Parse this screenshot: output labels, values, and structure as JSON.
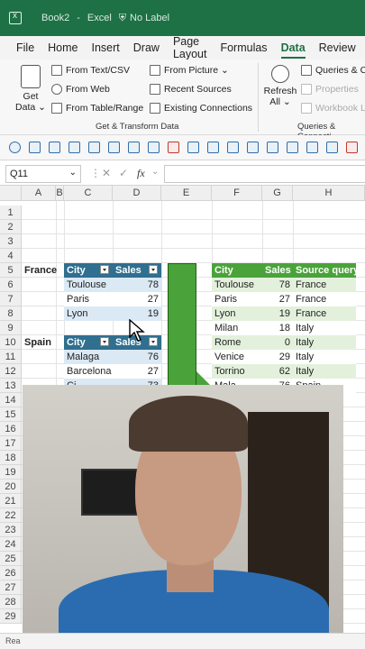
{
  "title_bar": {
    "app_icon": "excel-icon",
    "book": "Book2",
    "separator": "-",
    "app": "Excel",
    "label_icon": "shield-icon",
    "label": "No Label"
  },
  "menu": [
    "File",
    "Home",
    "Insert",
    "Draw",
    "Page Layout",
    "Formulas",
    "Data",
    "Review"
  ],
  "menu_active": "Data",
  "ribbon": {
    "get_data": "Get",
    "get_data2": "Data",
    "from_text_csv": "From Text/CSV",
    "from_web": "From Web",
    "from_table_range": "From Table/Range",
    "from_picture": "From Picture",
    "recent_sources": "Recent Sources",
    "existing_connections": "Existing Connections",
    "group_get_transform": "Get & Transform Data",
    "refresh": "Refresh",
    "refresh_all": "All",
    "queries_conn": "Queries & Co",
    "properties": "Properties",
    "workbook_links": "Workbook Li",
    "group_queries": "Queries & Connecti"
  },
  "formula_bar": {
    "name_box": "Q11",
    "fx": "fx",
    "formula": ""
  },
  "columns": [
    "A",
    "B",
    "C",
    "D",
    "E",
    "F",
    "G",
    "H"
  ],
  "rows": [
    "1",
    "2",
    "3",
    "4",
    "5",
    "6",
    "7",
    "8",
    "9",
    "10",
    "11",
    "12",
    "13",
    "14",
    "15",
    "16",
    "17",
    "18",
    "19",
    "20",
    "21",
    "22",
    "23",
    "24",
    "25",
    "26",
    "27",
    "28",
    "29"
  ],
  "sheet": {
    "france_label": "France",
    "spain_label": "Spain",
    "france_table": {
      "headers": [
        "City",
        "Sales"
      ],
      "rows": [
        [
          "Toulouse",
          "78"
        ],
        [
          "Paris",
          "27"
        ],
        [
          "Lyon",
          "19"
        ]
      ]
    },
    "spain_table": {
      "headers": [
        "City",
        "Sales"
      ],
      "rows": [
        [
          "Malaga",
          "76"
        ],
        [
          "Barcelona",
          "27"
        ],
        [
          "Ci",
          "73"
        ]
      ]
    },
    "combined_table": {
      "headers": [
        "City",
        "Sales",
        "Source query"
      ],
      "rows": [
        [
          "Toulouse",
          "78",
          "France"
        ],
        [
          "Paris",
          "27",
          "France"
        ],
        [
          "Lyon",
          "19",
          "France"
        ],
        [
          "Milan",
          "18",
          "Italy"
        ],
        [
          "Rome",
          "0",
          "Italy"
        ],
        [
          "Venice",
          "29",
          "Italy"
        ],
        [
          "Torrino",
          "62",
          "Italy"
        ],
        [
          "Mala",
          "76",
          "Spain"
        ]
      ]
    }
  },
  "status_bar": {
    "text": "Rea"
  },
  "colors": {
    "excel_green": "#1e7145",
    "table_blue": "#2f6f8f",
    "table_green": "#4aa33a"
  }
}
